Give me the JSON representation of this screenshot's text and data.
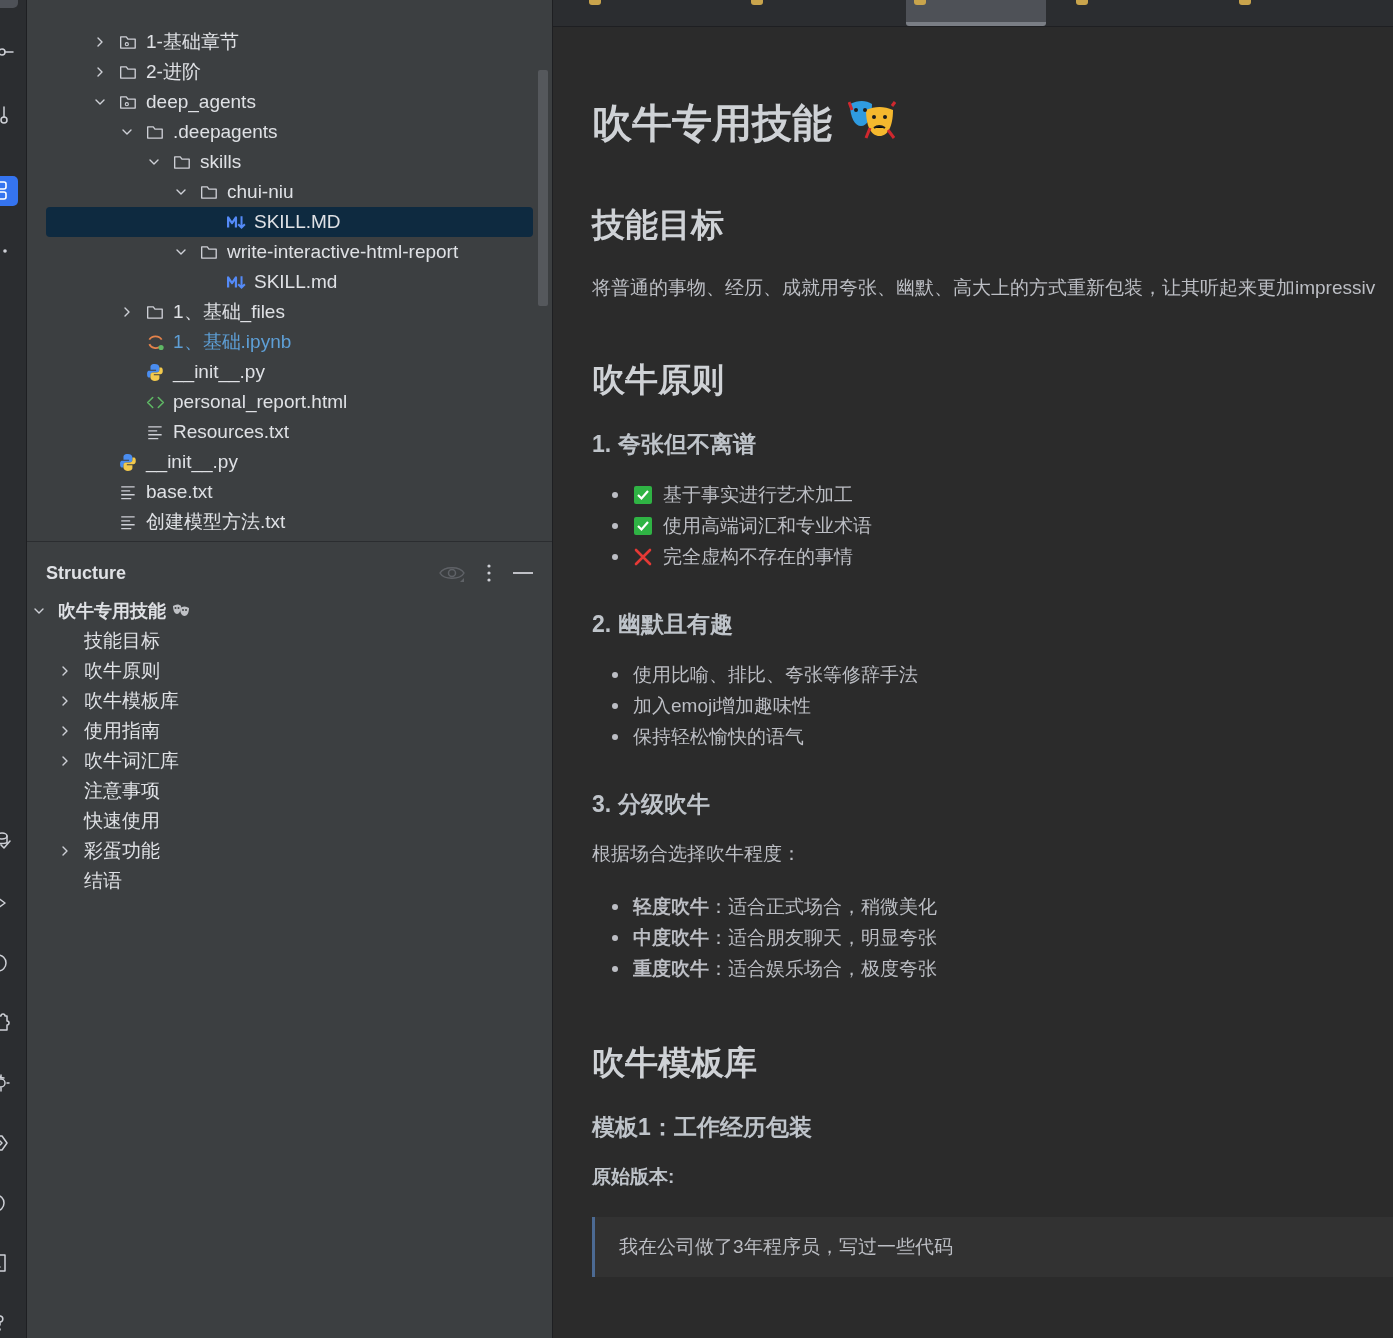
{
  "tool_strip": [
    {
      "kind": "box",
      "selected": false
    },
    {
      "kind": "commit",
      "selected": false
    },
    {
      "kind": "branch",
      "selected": false
    },
    {
      "kind": "project",
      "selected": true
    },
    {
      "kind": "dot",
      "selected": false
    },
    {
      "kind": "db",
      "selected": false
    },
    {
      "kind": "run",
      "selected": false
    },
    {
      "kind": "clock",
      "selected": false
    },
    {
      "kind": "puzzle",
      "selected": false
    },
    {
      "kind": "gear",
      "selected": false
    },
    {
      "kind": "hex",
      "selected": false
    },
    {
      "kind": "circle",
      "selected": false
    },
    {
      "kind": "terminal",
      "selected": false
    },
    {
      "kind": "question",
      "selected": false
    }
  ],
  "editor_tabs": [
    {
      "selected": false
    },
    {
      "selected": false
    },
    {
      "selected": true
    },
    {
      "selected": false
    },
    {
      "selected": false
    }
  ],
  "project_tree": [
    {
      "label": "1-基础章节",
      "kind": "module",
      "expanded": false,
      "selected": false,
      "color": "#dfe1e5"
    },
    {
      "label": "2-进阶",
      "kind": "folder",
      "expanded": false,
      "selected": false,
      "color": "#dfe1e5"
    },
    {
      "label": "deep_agents",
      "kind": "module",
      "expanded": true,
      "selected": false,
      "color": "#dfe1e5",
      "children": [
        {
          "label": ".deepagents",
          "kind": "folder",
          "expanded": true,
          "selected": false,
          "color": "#dfe1e5",
          "children": [
            {
              "label": "skills",
              "kind": "folder",
              "expanded": true,
              "selected": false,
              "color": "#dfe1e5",
              "children": [
                {
                  "label": "chui-niu",
                  "kind": "folder",
                  "expanded": true,
                  "selected": false,
                  "color": "#dfe1e5",
                  "children": [
                    {
                      "label": "SKILL.MD",
                      "kind": "markdown",
                      "selected": true,
                      "color": "#dfe1e5"
                    }
                  ]
                },
                {
                  "label": "write-interactive-html-report",
                  "kind": "folder",
                  "expanded": true,
                  "selected": false,
                  "color": "#dfe1e5",
                  "children": [
                    {
                      "label": "SKILL.md",
                      "kind": "markdown",
                      "selected": false,
                      "color": "#dfe1e5"
                    }
                  ]
                }
              ]
            }
          ]
        },
        {
          "label": "1、基础_files",
          "kind": "folder",
          "expanded": false,
          "selected": false,
          "color": "#dfe1e5"
        },
        {
          "label": "1、基础.ipynb",
          "kind": "notebook",
          "selected": false,
          "color": "#5e9fd6"
        },
        {
          "label": "__init__.py",
          "kind": "python",
          "selected": false,
          "color": "#dfe1e5"
        },
        {
          "label": "personal_report.html",
          "kind": "html",
          "selected": false,
          "color": "#dfe1e5"
        },
        {
          "label": "Resources.txt",
          "kind": "text",
          "selected": false,
          "color": "#dfe1e5"
        }
      ]
    },
    {
      "label": "__init__.py",
      "kind": "python",
      "selected": false,
      "color": "#dfe1e5"
    },
    {
      "label": "base.txt",
      "kind": "text",
      "selected": false,
      "color": "#dfe1e5"
    },
    {
      "label": "创建模型方法.txt",
      "kind": "text",
      "selected": false,
      "color": "#dfe1e5"
    }
  ],
  "structure": {
    "title": "Structure",
    "root": {
      "label": "吹牛专用技能",
      "expanded": true,
      "children": [
        {
          "label": "技能目标",
          "expandable": false
        },
        {
          "label": "吹牛原则",
          "expandable": true
        },
        {
          "label": "吹牛模板库",
          "expandable": true
        },
        {
          "label": "使用指南",
          "expandable": true
        },
        {
          "label": "吹牛词汇库",
          "expandable": true
        },
        {
          "label": "注意事项",
          "expandable": false
        },
        {
          "label": "快速使用",
          "expandable": false
        },
        {
          "label": "彩蛋功能",
          "expandable": true
        },
        {
          "label": "结语",
          "expandable": false
        }
      ]
    }
  },
  "document": [
    {
      "kind": "h1",
      "text": "吹牛专用技能"
    },
    {
      "kind": "h2",
      "text": "技能目标"
    },
    {
      "kind": "p",
      "text": "将普通的事物、经历、成就用夸张、幽默、高大上的方式重新包装，让其听起来更加impressiv"
    },
    {
      "kind": "h2",
      "text": "吹牛原则"
    },
    {
      "kind": "h3",
      "text": "1. 夸张但不离谱"
    },
    {
      "kind": "ul",
      "items": [
        {
          "text": "基于事实进行艺术加工",
          "kind": "check"
        },
        {
          "text": "使用高端词汇和专业术语",
          "kind": "check"
        },
        {
          "text": "完全虚构不存在的事情",
          "kind": "cross"
        }
      ]
    },
    {
      "kind": "h3",
      "text": "2. 幽默且有趣"
    },
    {
      "kind": "ul",
      "items": [
        {
          "text": "使用比喻、排比、夸张等修辞手法"
        },
        {
          "text": "加入emoji增加趣味性"
        },
        {
          "text": "保持轻松愉快的语气"
        }
      ]
    },
    {
      "kind": "h3",
      "text": "3. 分级吹牛"
    },
    {
      "kind": "p",
      "text": "根据场合选择吹牛程度："
    },
    {
      "kind": "ul",
      "items": [
        {
          "text": "**轻度吹牛**：适合正式场合，稍微美化"
        },
        {
          "text": "**中度吹牛**：适合朋友聊天，明显夸张"
        },
        {
          "text": "**重度吹牛**：适合娱乐场合，极度夸张"
        }
      ]
    },
    {
      "kind": "h2",
      "text": "吹牛模板库"
    },
    {
      "kind": "h3",
      "text": "模板1：工作经历包装"
    },
    {
      "kind": "strong",
      "text": "原始版本:"
    },
    {
      "kind": "quote",
      "text": "我在公司做了3年程序员，写过一些代码"
    }
  ]
}
